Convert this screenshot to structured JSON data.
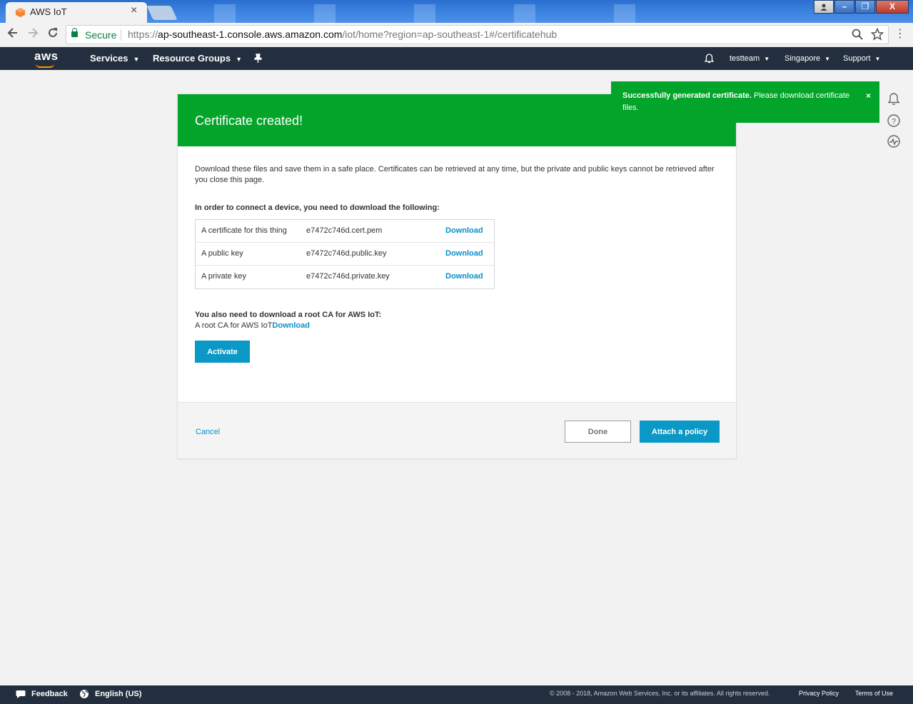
{
  "browser": {
    "tab_title": "AWS IoT",
    "tab_close": "×",
    "secure_label": "Secure",
    "url_scheme": "https://",
    "url_host": "ap-southeast-1.console.aws.amazon.com",
    "url_path": "/iot/home?region=ap-southeast-1#/certificatehub",
    "window_buttons": {
      "minimize": "–",
      "restore": "❐",
      "close": "X"
    }
  },
  "aws_nav": {
    "logo": "aws",
    "services": "Services",
    "resource_groups": "Resource Groups",
    "account": "testteam",
    "region": "Singapore",
    "support": "Support"
  },
  "toast": {
    "bold_text": "Successfully generated certificate.",
    "text": " Please download certificate files.",
    "close": "×"
  },
  "card": {
    "title": "Certificate created!",
    "intro": "Download these files and save them in a safe place. Certificates can be retrieved at any time, but the private and public keys cannot be retrieved after you close this page.",
    "required_heading": "In order to connect a device, you need to download the following:",
    "files": [
      {
        "label": "A certificate for this thing",
        "filename": "e7472c746d.cert.pem",
        "action": "Download"
      },
      {
        "label": "A public key",
        "filename": "e7472c746d.public.key",
        "action": "Download"
      },
      {
        "label": "A private key",
        "filename": "e7472c746d.private.key",
        "action": "Download"
      }
    ],
    "root_ca_heading": "You also need to download a root CA for AWS IoT:",
    "root_ca_label": "A root CA for AWS IoT",
    "root_ca_action": "Download",
    "activate_label": "Activate",
    "cancel_label": "Cancel",
    "done_label": "Done",
    "attach_label": "Attach a policy"
  },
  "footer": {
    "feedback": "Feedback",
    "language": "English (US)",
    "copyright": "© 2008 - 2018, Amazon Web Services, Inc. or its affiliates. All rights reserved.",
    "privacy": "Privacy Policy",
    "terms": "Terms of Use"
  },
  "colors": {
    "success_green": "#03a42a",
    "aws_navy": "#232f3e",
    "link_blue": "#0a8fc7",
    "button_blue": "#0a98c7",
    "aws_orange": "#ff9900"
  },
  "icons": [
    "back-icon",
    "forward-icon",
    "reload-icon",
    "lock-icon",
    "zoom-icon",
    "star-icon",
    "menu-icon",
    "bell-icon",
    "pin-icon",
    "help-icon",
    "activity-icon",
    "chat-icon",
    "globe-icon"
  ]
}
